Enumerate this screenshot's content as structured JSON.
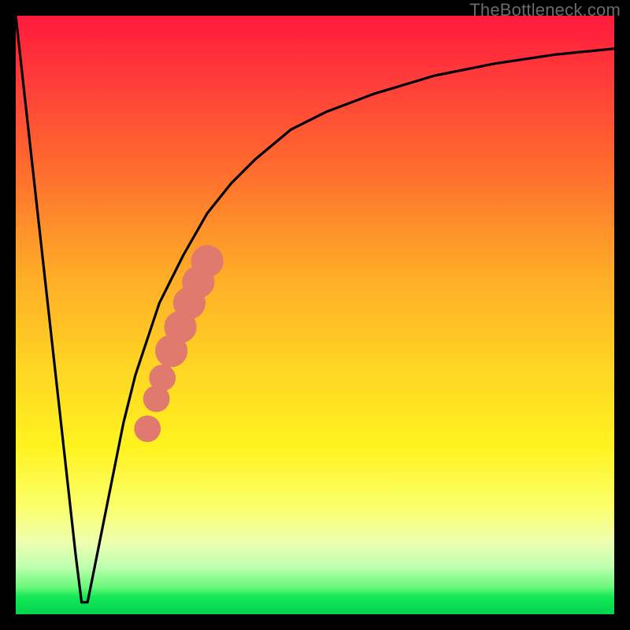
{
  "watermark": {
    "text": "TheBottleneck.com"
  },
  "chart_data": {
    "type": "line",
    "title": "",
    "xlabel": "",
    "ylabel": "",
    "xlim": [
      0,
      100
    ],
    "ylim": [
      0,
      100
    ],
    "grid": false,
    "legend": false,
    "background_gradient": {
      "direction": "vertical",
      "stops": [
        {
          "pos": 0.0,
          "color": "#ff1a3c"
        },
        {
          "pos": 0.25,
          "color": "#ff6a2e"
        },
        {
          "pos": 0.5,
          "color": "#ffc324"
        },
        {
          "pos": 0.72,
          "color": "#fff31f"
        },
        {
          "pos": 0.92,
          "color": "#c0ffb0"
        },
        {
          "pos": 1.0,
          "color": "#00d44c"
        }
      ]
    },
    "series": [
      {
        "name": "bottleneck-curve",
        "color": "#000000",
        "x": [
          0,
          2,
          4,
          6,
          8,
          10,
          11,
          12,
          14,
          16,
          18,
          20,
          24,
          28,
          32,
          36,
          40,
          46,
          52,
          60,
          70,
          80,
          90,
          100
        ],
        "y": [
          100,
          82,
          64,
          46,
          28,
          10,
          2,
          2,
          12,
          22,
          32,
          40,
          52,
          60,
          67,
          72,
          76,
          81,
          84,
          87,
          90,
          92,
          93.5,
          94.5
        ]
      }
    ],
    "scatter_overlay": {
      "name": "highlight-segment",
      "color": "#e07a6e",
      "points": [
        {
          "x": 22.0,
          "y": 31.0,
          "r": 1.2
        },
        {
          "x": 23.5,
          "y": 36.0,
          "r": 1.2
        },
        {
          "x": 24.5,
          "y": 39.5,
          "r": 1.2
        },
        {
          "x": 26.0,
          "y": 44.0,
          "r": 1.6
        },
        {
          "x": 27.5,
          "y": 48.0,
          "r": 1.6
        },
        {
          "x": 29.0,
          "y": 52.0,
          "r": 1.6
        },
        {
          "x": 30.5,
          "y": 55.5,
          "r": 1.6
        },
        {
          "x": 32.0,
          "y": 59.0,
          "r": 1.6
        }
      ]
    }
  }
}
